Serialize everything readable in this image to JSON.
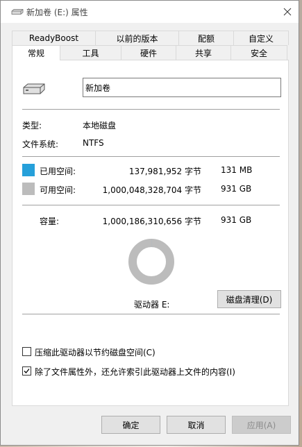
{
  "window": {
    "title": "新加卷 (E:) 属性"
  },
  "tabs_top": [
    "ReadyBoost",
    "以前的版本",
    "配额",
    "自定义"
  ],
  "tabs_bottom": [
    "常规",
    "工具",
    "硬件",
    "共享",
    "安全"
  ],
  "general": {
    "volume_name": "新加卷",
    "type_label": "类型:",
    "type_value": "本地磁盘",
    "fs_label": "文件系统:",
    "fs_value": "NTFS",
    "used": {
      "label": "已用空间:",
      "bytes": "137,981,952 字节",
      "size": "131 MB",
      "color": "#26a0da"
    },
    "free": {
      "label": "可用空间:",
      "bytes": "1,000,048,328,704 字节",
      "size": "931 GB",
      "color": "#bcbcbc"
    },
    "capacity": {
      "label": "容量:",
      "bytes": "1,000,186,310,656 字节",
      "size": "931 GB"
    },
    "used_fraction": 0.000138,
    "drive_label": "驱动器 E:",
    "cleanup_button": "磁盘清理(D)",
    "compress_label": "压缩此驱动器以节约磁盘空间(C)",
    "compress_checked": false,
    "index_label": "除了文件属性外，还允许索引此驱动器上文件的内容(I)",
    "index_checked": true
  },
  "buttons": {
    "ok": "确定",
    "cancel": "取消",
    "apply": "应用(A)"
  }
}
